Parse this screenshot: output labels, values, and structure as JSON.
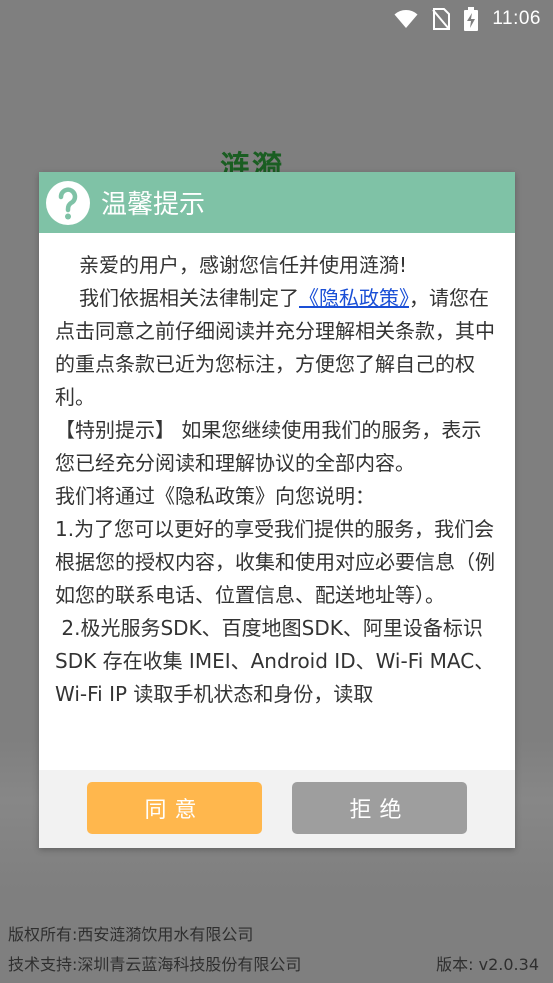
{
  "status_bar": {
    "time": "11:06",
    "icons": [
      "wifi-icon",
      "no-sim-icon",
      "battery-charging-icon"
    ]
  },
  "background": {
    "logo_text": "涟漪"
  },
  "dialog": {
    "title": "温馨提示",
    "icon": "help-icon",
    "paragraphs": {
      "p1": "亲爱的用户，感谢您信任并使用涟漪!",
      "p2_prefix": "我们依据相关法律制定了",
      "p2_link": "《隐私政策》",
      "p2_suffix": "，请您在点击同意之前仔细阅读并充分理解相关条款，其中的重点条款已近为您标注，方便您了解自己的权利。",
      "p3": "【特别提示】 如果您继续使用我们的服务，表示您已经充分阅读和理解协议的全部内容。",
      "p4": "我们将通过《隐私政策》向您说明：",
      "p5": "1.为了您可以更好的享受我们提供的服务，我们会根据您的授权内容，收集和使用对应必要信息（例如您的联系电话、位置信息、配送地址等）。",
      "p6": " 2.极光服务SDK、百度地图SDK、阿里设备标识SDK 存在收集 IMEI、Android ID、Wi-Fi MAC、Wi-Fi IP 读取手机状态和身份，读取"
    },
    "buttons": {
      "agree": "同意",
      "refuse": "拒绝"
    }
  },
  "footer": {
    "copyright": "版权所有:西安涟漪饮用水有限公司",
    "tech_support": "技术支持:深圳青云蓝海科技股份有限公司",
    "version": "版本: v2.0.34"
  },
  "colors": {
    "header": "#7fc2a6",
    "agree_button": "#ffb74d",
    "refuse_button": "#9e9e9e",
    "link": "#1a4fd6"
  }
}
